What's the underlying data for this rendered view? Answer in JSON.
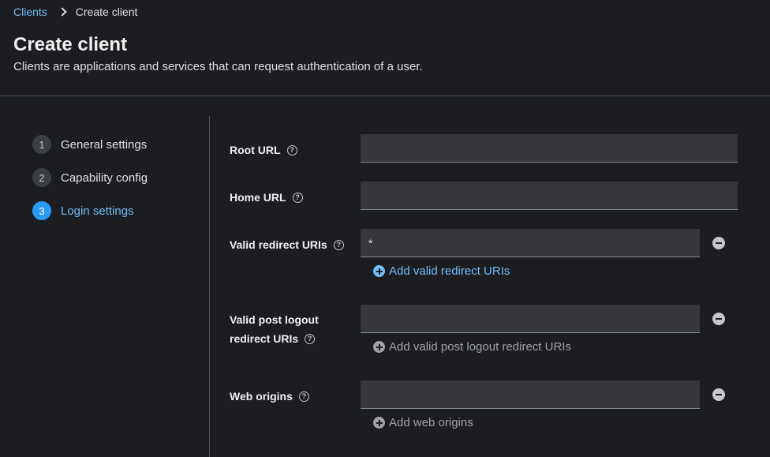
{
  "breadcrumb": {
    "parent": "Clients",
    "current": "Create client"
  },
  "header": {
    "title": "Create client",
    "description": "Clients are applications and services that can request authentication of a user."
  },
  "wizard": {
    "steps": [
      {
        "number": "1",
        "label": "General settings"
      },
      {
        "number": "2",
        "label": "Capability config"
      },
      {
        "number": "3",
        "label": "Login settings"
      }
    ],
    "active_step": 3
  },
  "form": {
    "root_url": {
      "label": "Root URL",
      "value": ""
    },
    "home_url": {
      "label": "Home URL",
      "value": ""
    },
    "valid_redirect_uris": {
      "label": "Valid redirect URIs",
      "value": "*",
      "add_label": "Add valid redirect URIs"
    },
    "valid_post_logout": {
      "label_line1": "Valid post logout",
      "label_line2": "redirect URIs",
      "value": "",
      "add_label": "Add valid post logout redirect URIs"
    },
    "web_origins": {
      "label": "Web origins",
      "value": "",
      "add_label": "Add web origins"
    },
    "help_glyph": "?"
  },
  "colors": {
    "accent": "#73bcf7",
    "active_step": "#2b9af3",
    "background": "#1b1d21"
  }
}
